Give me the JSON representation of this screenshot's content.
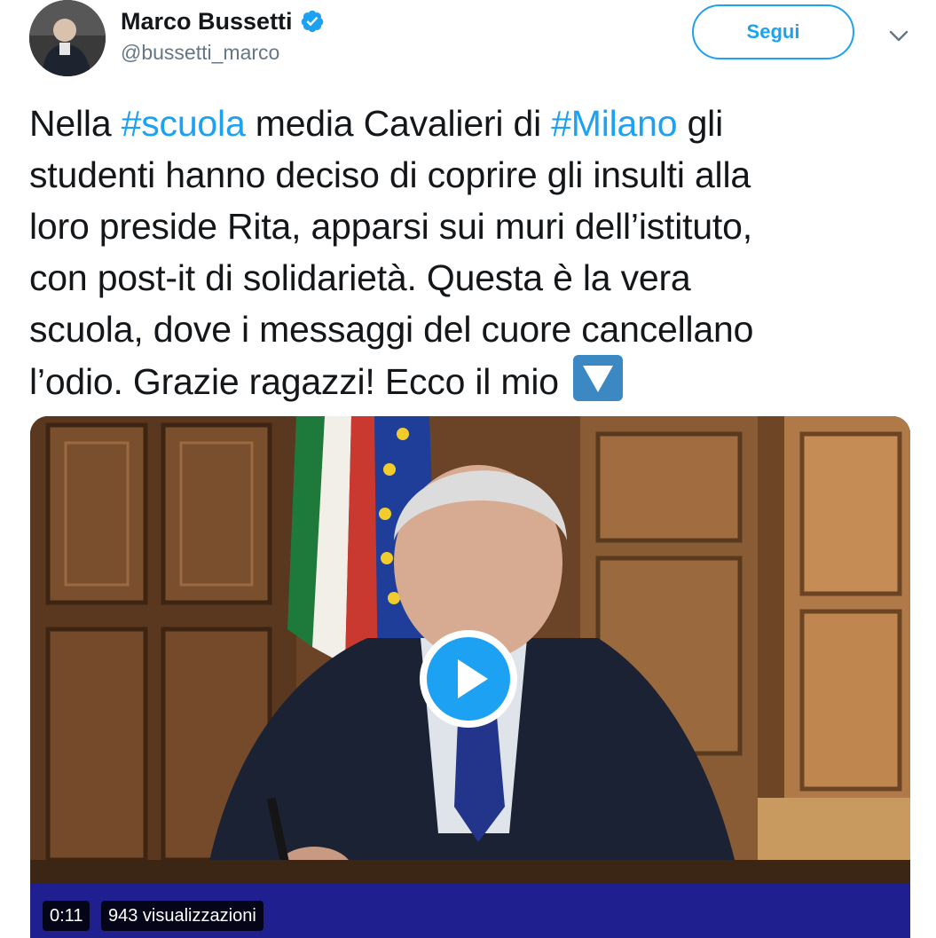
{
  "user": {
    "display_name": "Marco Bussetti",
    "handle": "@bussetti_marco",
    "verified": true,
    "avatar_icon": "profile-photo"
  },
  "follow_button": {
    "label": "Segui"
  },
  "more_menu_icon": "chevron-down-icon",
  "tweet": {
    "lines": [
      [
        "Nella ",
        "#scuola",
        " media Cavalieri di ",
        "#Milano",
        " gli"
      ],
      [
        "studenti hanno deciso di coprire gli insulti alla"
      ],
      [
        "loro preside Rita, apparsi sui muri dell’istituto,"
      ],
      [
        "con post-it di solidarietà. Questa è la vera"
      ],
      [
        "scuola, dove i messaggi del cuore cancellano"
      ],
      [
        "l’odio. Grazie ragazzi! Ecco il mio "
      ]
    ],
    "hashtags": [
      "#scuola",
      "#Milano"
    ],
    "trailing_emoji": "down-button-emoji"
  },
  "video": {
    "duration": "0:11",
    "views": "943 visualizzazioni",
    "play_icon": "play-icon"
  },
  "colors": {
    "accent": "#1da1f2",
    "text": "#14171a",
    "secondary_text": "#657786",
    "emoji_blue": "#3b88c3"
  }
}
